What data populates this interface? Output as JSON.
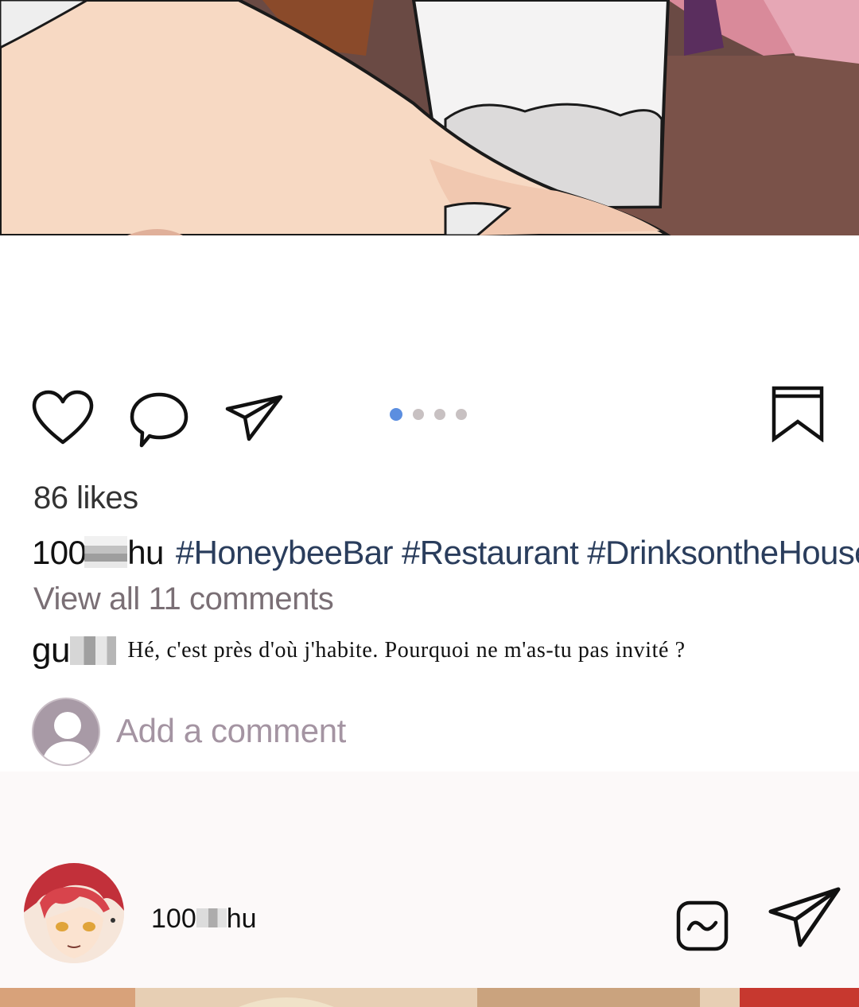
{
  "post": {
    "likes_text": "86 likes",
    "caption": {
      "username_start": "100",
      "username_end": "hu",
      "hashtags": "#HoneybeeBar #Restaurant #DrinksontheHouse"
    },
    "view_comments_label": "View all 11 comments",
    "carousel": {
      "count": 4,
      "active_index": 0
    },
    "comment": {
      "username_start": "gu",
      "text": "Hé, c'est près d'où j'habite. Pourquoi ne m'as-tu pas invité ?"
    },
    "add_comment_placeholder": "Add a comment"
  },
  "next_post": {
    "username_start": "100",
    "username_end": "hu"
  },
  "icons": {
    "like": "heart-icon",
    "comment": "speech-bubble-icon",
    "share": "paper-plane-icon",
    "save": "bookmark-icon",
    "message": "message-icon",
    "send": "paper-plane-icon"
  },
  "colors": {
    "hashtag": "#2a3d5c",
    "carousel_active": "#5b8ee0",
    "carousel_inactive": "#c8c1c2",
    "muted_text": "#7a6f75",
    "placeholder": "#a494a2"
  }
}
